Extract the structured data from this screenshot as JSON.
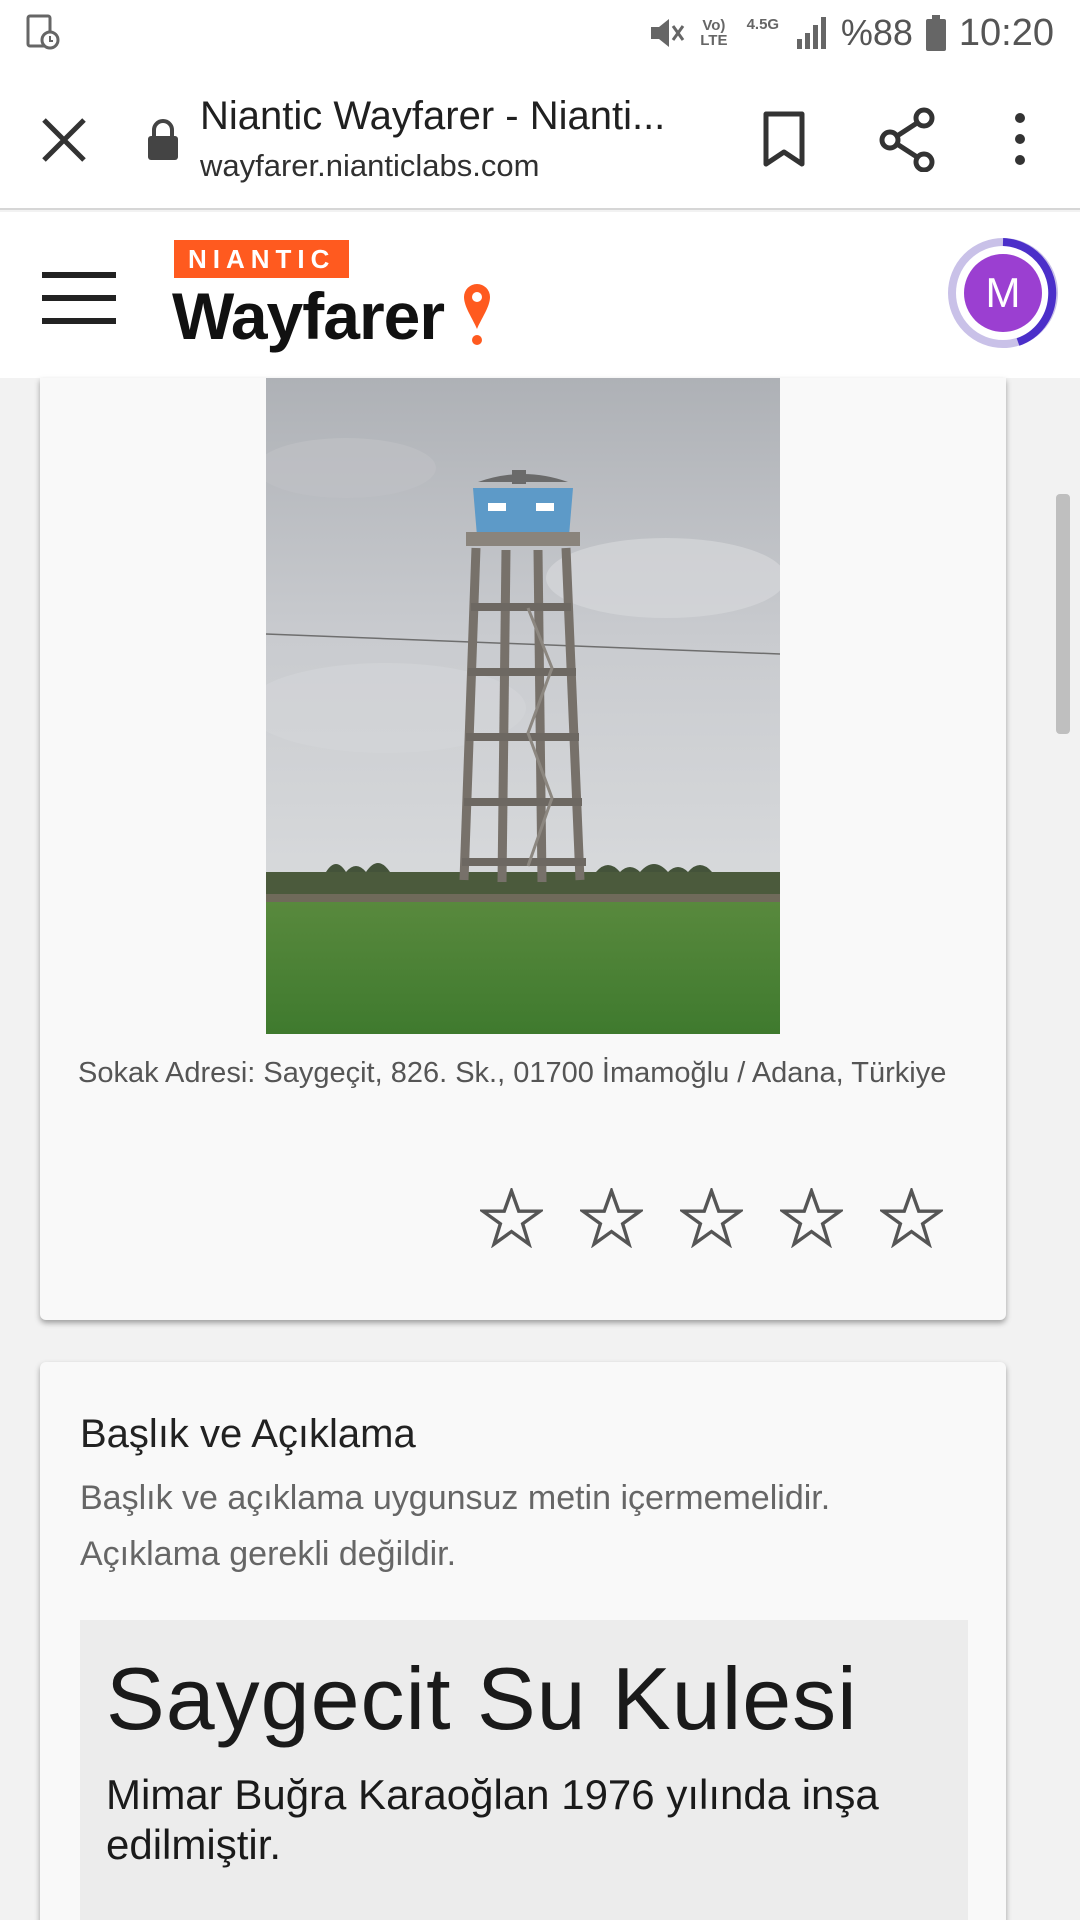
{
  "status_bar": {
    "battery_percent": "%88",
    "time": "10:20",
    "volte_label": "Vo) LTE",
    "network_label": "4.5G",
    "icons": [
      "screen-record-icon",
      "mute-icon",
      "volte-icon",
      "data-arrows-icon",
      "signal-icon",
      "battery-icon"
    ]
  },
  "browser": {
    "page_title": "Niantic Wayfarer - Nianti...",
    "url": "wayfarer.nianticlabs.com",
    "icons": [
      "close-icon",
      "lock-icon",
      "bookmark-icon",
      "share-icon",
      "more-vert-icon"
    ]
  },
  "app_header": {
    "brand_top": "NIANTIC",
    "brand_name": "Wayfarer",
    "avatar_initial": "M",
    "colors": {
      "brand_orange": "#ff5a1f",
      "avatar_purple": "#9b3fd1",
      "ring_dark": "#4b2fc9",
      "ring_light": "#c9c1e8"
    }
  },
  "photo_card": {
    "photo_alt": "water tower photo",
    "address": "Sokak Adresi: Saygeçit, 826. Sk., 01700 İmamoğlu / Adana, Türkiye",
    "rating": {
      "filled": 0,
      "max": 5
    }
  },
  "title_card": {
    "heading": "Başlık ve Açıklama",
    "instruction": "Başlık ve açıklama uygunsuz metin içermemelidir. Açıklama gerekli değildir.",
    "poi_title": "Saygecit Su Kulesi",
    "poi_description": "Mimar Buğra Karaoğlan 1976 yılında inşa edilmiştir."
  }
}
